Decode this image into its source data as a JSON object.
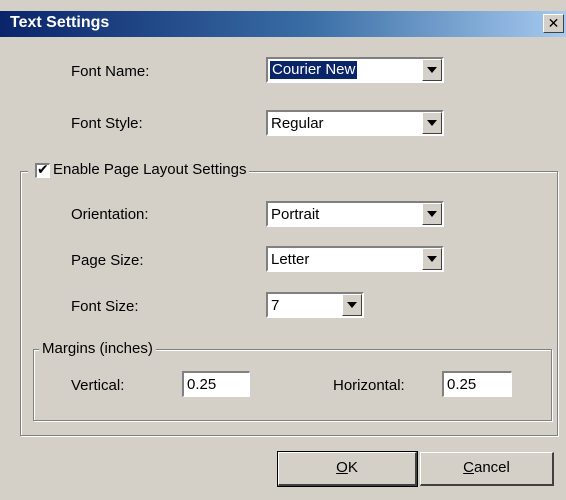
{
  "window": {
    "title": "Text Settings",
    "close_glyph": "✕"
  },
  "font": {
    "name_label": "Font Name:",
    "name_value": "Courier New",
    "style_label": "Font Style:",
    "style_value": "Regular"
  },
  "layout": {
    "enable_label": "Enable Page Layout Settings",
    "enable_checked": true,
    "orientation_label": "Orientation:",
    "orientation_value": "Portrait",
    "page_size_label": "Page Size:",
    "page_size_value": "Letter",
    "font_size_label": "Font Size:",
    "font_size_value": "7"
  },
  "margins": {
    "caption": "Margins (inches)",
    "vertical_label": "Vertical:",
    "vertical_value": "0.25",
    "horizontal_label": "Horizontal:",
    "horizontal_value": "0.25"
  },
  "buttons": {
    "ok_mnemonic": "O",
    "ok_rest": "K",
    "cancel_mnemonic": "C",
    "cancel_rest": "ancel"
  },
  "colors": {
    "face": "#d4d0c8",
    "title_start": "#0a246a",
    "title_end": "#a6caf0"
  },
  "icons": {
    "close": "close-icon",
    "dropdown": "chevron-down-icon",
    "check": "checkmark-icon"
  }
}
